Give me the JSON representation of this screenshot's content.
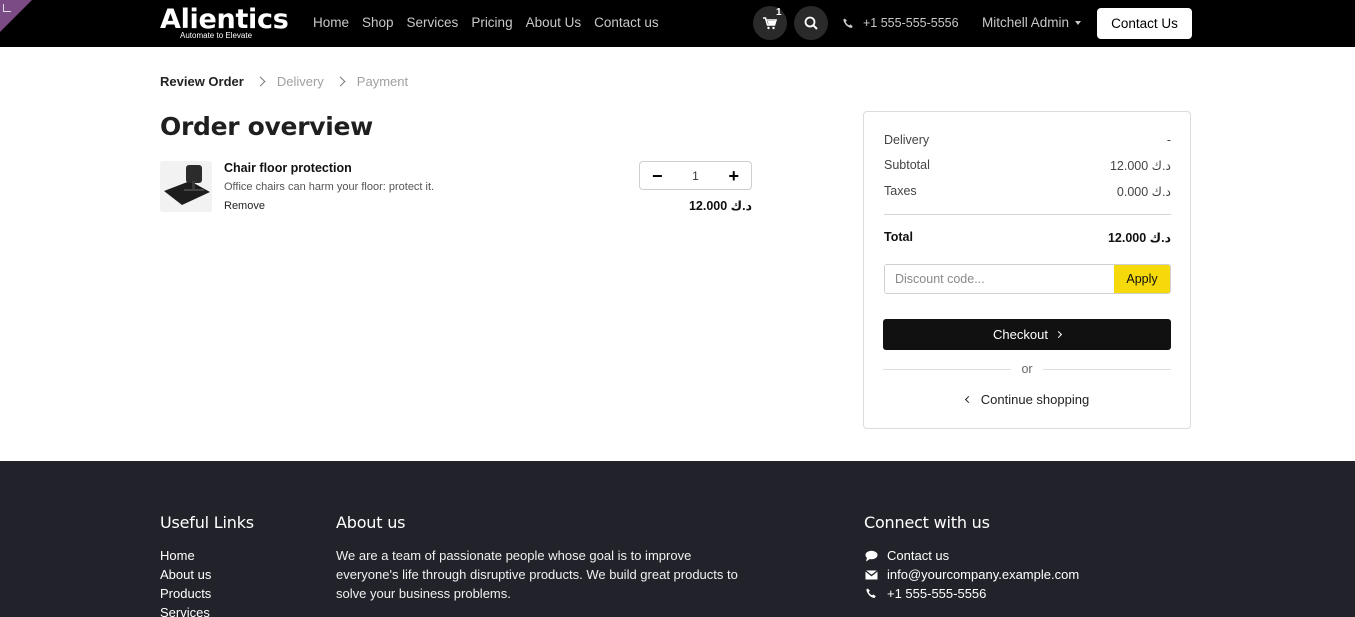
{
  "header": {
    "logo_text": "Alientics",
    "logo_tagline": "Automate to Elevate",
    "nav": [
      "Home",
      "Shop",
      "Services",
      "Pricing",
      "About Us",
      "Contact us"
    ],
    "cart_count": "1",
    "phone": "+1 555-555-5556",
    "user_name": "Mitchell Admin",
    "contact_button": "Contact Us"
  },
  "breadcrumb": {
    "steps": [
      "Review Order",
      "Delivery",
      "Payment"
    ]
  },
  "page_title": "Order overview",
  "cart_line": {
    "product_name": "Chair floor protection",
    "description": "Office chairs can harm your floor: protect it.",
    "remove_label": "Remove",
    "quantity": "1",
    "price": "د.ك 12.000"
  },
  "summary": {
    "delivery_label": "Delivery",
    "delivery_value": "-",
    "subtotal_label": "Subtotal",
    "subtotal_value": "د.ك 12.000",
    "taxes_label": "Taxes",
    "taxes_value": "د.ك 0.000",
    "total_label": "Total",
    "total_value": "د.ك 12.000",
    "discount_placeholder": "Discount code...",
    "apply_label": "Apply",
    "checkout_label": "Checkout",
    "or_label": "or",
    "continue_label": "Continue shopping"
  },
  "footer": {
    "links_title": "Useful Links",
    "links": [
      "Home",
      "About us",
      "Products",
      "Services"
    ],
    "about_title": "About us",
    "about_text": "We are a team of passionate people whose goal is to improve everyone's life through disruptive products. We build great products to solve your business problems.",
    "connect_title": "Connect with us",
    "connect_contact": "Contact us",
    "connect_email": "info@yourcompany.example.com",
    "connect_phone": "+1 555-555-5556"
  },
  "colors": {
    "header_bg": "#000000",
    "footer_bg": "#22232a",
    "apply_button": "#f5d90a",
    "checkout_button": "#111111",
    "corner_accent": "#7a4b85"
  },
  "icons": [
    "cart-icon",
    "search-icon",
    "phone-icon",
    "chat-icon",
    "envelope-icon"
  ]
}
